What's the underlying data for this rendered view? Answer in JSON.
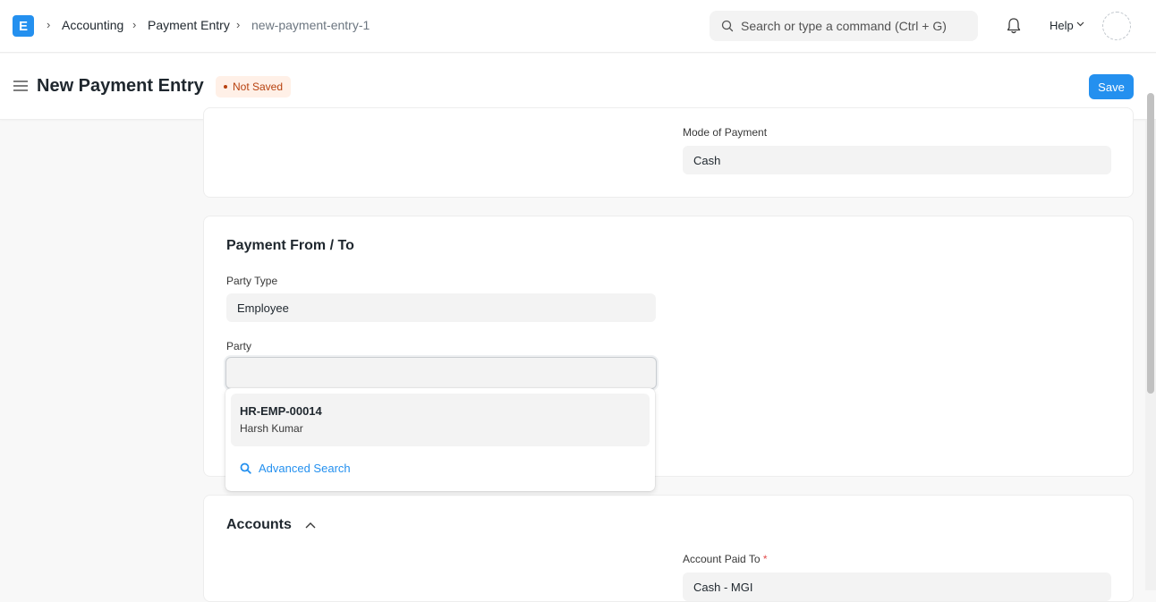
{
  "navbar": {
    "logo_letter": "E",
    "breadcrumbs": [
      "Accounting",
      "Payment Entry",
      "new-payment-entry-1"
    ],
    "search_placeholder": "Search or type a command (Ctrl + G)",
    "help_label": "Help"
  },
  "header": {
    "title": "New Payment Entry",
    "status": "Not Saved",
    "save_label": "Save"
  },
  "top_card": {
    "mode_of_payment_label": "Mode of Payment",
    "mode_of_payment_value": "Cash"
  },
  "payment_from_to": {
    "title": "Payment From / To",
    "party_type_label": "Party Type",
    "party_type_value": "Employee",
    "party_label": "Party",
    "party_value": ""
  },
  "party_dropdown": {
    "items": [
      {
        "code": "HR-EMP-00014",
        "name": "Harsh Kumar"
      }
    ],
    "advanced_search_label": "Advanced Search"
  },
  "accounts": {
    "title": "Accounts",
    "account_paid_to_label": "Account Paid To",
    "account_paid_to_value": "Cash - MGI"
  },
  "colors": {
    "primary": "#2490ef",
    "status_text": "#b7410e",
    "status_bg": "#fff0e7"
  }
}
